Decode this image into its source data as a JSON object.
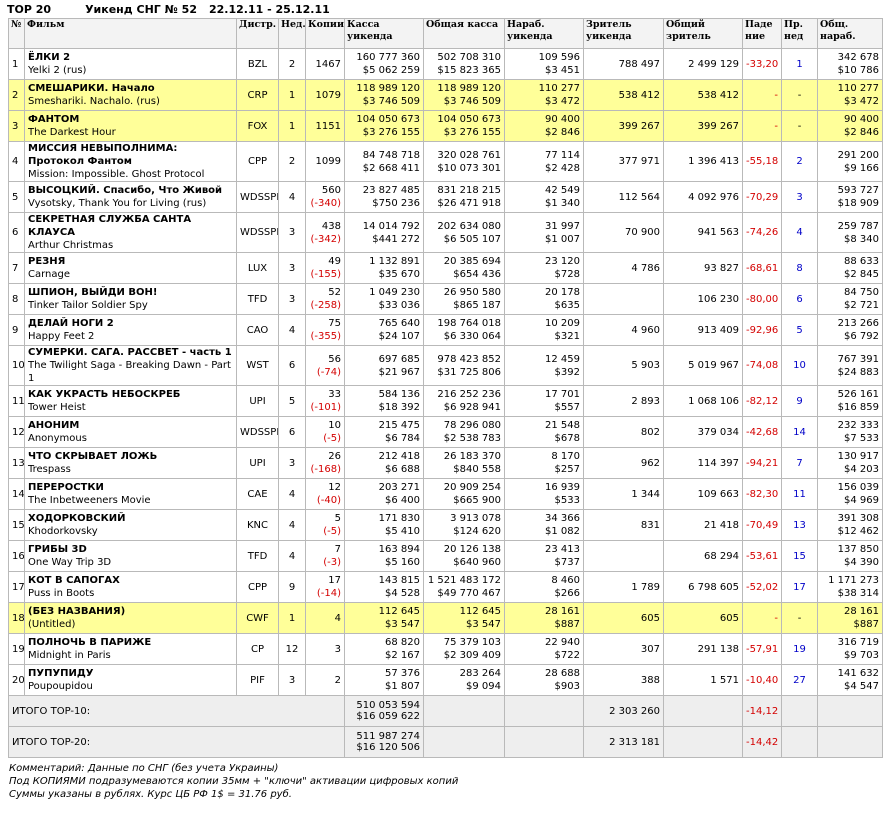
{
  "header": {
    "top": "TOP 20",
    "weekend": "Уикенд СНГ № 52",
    "dates": "22.12.11 - 25.12.11"
  },
  "columns": [
    "№",
    "Фильм",
    "Дистр.",
    "Нед.",
    "Копии",
    "Касса уикенда",
    "Общая касса",
    "Нараб. уикенда",
    "Зритель уикенда",
    "Общий зритель",
    "Паде ние",
    "Пр. нед",
    "Общ. нараб."
  ],
  "rows": [
    {
      "n": "1",
      "ru": "ЁЛКИ 2",
      "en": "Yelki 2 (rus)",
      "dist": "BZL",
      "week": "2",
      "copies": "1467",
      "copies_d": "",
      "box1": "160 777 360",
      "box2": "$5 062 259",
      "tot1": "502 708 310",
      "tot2": "$15 823 365",
      "avg1": "109 596",
      "avg2": "$3 451",
      "adm": "788 497",
      "tadm": "2 499 129",
      "drop": "-33,20",
      "prev": "1",
      "cavg1": "342 678",
      "cavg2": "$10 786",
      "hl": false
    },
    {
      "n": "2",
      "ru": "СМЕШАРИКИ. Начало",
      "en": "Smeshariki. Nachalo. (rus)",
      "dist": "CRP",
      "week": "1",
      "copies": "1079",
      "copies_d": "",
      "box1": "118 989 120",
      "box2": "$3 746 509",
      "tot1": "118 989 120",
      "tot2": "$3 746 509",
      "avg1": "110 277",
      "avg2": "$3 472",
      "adm": "538 412",
      "tadm": "538 412",
      "drop": "-",
      "prev": "-",
      "cavg1": "110 277",
      "cavg2": "$3 472",
      "hl": true
    },
    {
      "n": "3",
      "ru": "ФАНТОМ",
      "en": "The Darkest Hour",
      "dist": "FOX",
      "week": "1",
      "copies": "1151",
      "copies_d": "",
      "box1": "104 050 673",
      "box2": "$3 276 155",
      "tot1": "104 050 673",
      "tot2": "$3 276 155",
      "avg1": "90 400",
      "avg2": "$2 846",
      "adm": "399 267",
      "tadm": "399 267",
      "drop": "-",
      "prev": "-",
      "cavg1": "90 400",
      "cavg2": "$2 846",
      "hl": true
    },
    {
      "n": "4",
      "ru": "МИССИЯ НЕВЫПОЛНИМА: Протокол Фантом",
      "en": "Mission: Impossible. Ghost Protocol",
      "dist": "CPP",
      "week": "2",
      "copies": "1099",
      "copies_d": "",
      "box1": "84 748 718",
      "box2": "$2 668 411",
      "tot1": "320 028 761",
      "tot2": "$10 073 301",
      "avg1": "77 114",
      "avg2": "$2 428",
      "adm": "377 971",
      "tadm": "1 396 413",
      "drop": "-55,18",
      "prev": "2",
      "cavg1": "291 200",
      "cavg2": "$9 166",
      "hl": false
    },
    {
      "n": "5",
      "ru": "ВЫСОЦКИЙ. Спасибо, Что Живой",
      "en": "Vysotsky, Thank You for Living (rus)",
      "dist": "WDSSPR",
      "week": "4",
      "copies": "560",
      "copies_d": "(-340)",
      "box1": "23 827 485",
      "box2": "$750 236",
      "tot1": "831 218 215",
      "tot2": "$26 471 918",
      "avg1": "42 549",
      "avg2": "$1 340",
      "adm": "112 564",
      "tadm": "4 092 976",
      "drop": "-70,29",
      "prev": "3",
      "cavg1": "593 727",
      "cavg2": "$18 909",
      "hl": false
    },
    {
      "n": "6",
      "ru": "СЕКРЕТНАЯ СЛУЖБА САНТА КЛАУСА",
      "en": "Arthur Christmas",
      "dist": "WDSSPR",
      "week": "3",
      "copies": "438",
      "copies_d": "(-342)",
      "box1": "14 014 792",
      "box2": "$441 272",
      "tot1": "202 634 080",
      "tot2": "$6 505 107",
      "avg1": "31 997",
      "avg2": "$1 007",
      "adm": "70 900",
      "tadm": "941 563",
      "drop": "-74,26",
      "prev": "4",
      "cavg1": "259 787",
      "cavg2": "$8 340",
      "hl": false
    },
    {
      "n": "7",
      "ru": "РЕЗНЯ",
      "en": "Carnage",
      "dist": "LUX",
      "week": "3",
      "copies": "49",
      "copies_d": "(-155)",
      "box1": "1 132 891",
      "box2": "$35 670",
      "tot1": "20 385 694",
      "tot2": "$654 436",
      "avg1": "23 120",
      "avg2": "$728",
      "adm": "4 786",
      "tadm": "93 827",
      "drop": "-68,61",
      "prev": "8",
      "cavg1": "88 633",
      "cavg2": "$2 845",
      "hl": false
    },
    {
      "n": "8",
      "ru": "ШПИОН, ВЫЙДИ ВОН!",
      "en": "Tinker Tailor Soldier Spy",
      "dist": "TFD",
      "week": "3",
      "copies": "52",
      "copies_d": "(-258)",
      "box1": "1 049 230",
      "box2": "$33 036",
      "tot1": "26 950 580",
      "tot2": "$865 187",
      "avg1": "20 178",
      "avg2": "$635",
      "adm": "",
      "tadm": "106 230",
      "drop": "-80,00",
      "prev": "6",
      "cavg1": "84 750",
      "cavg2": "$2 721",
      "hl": false
    },
    {
      "n": "9",
      "ru": "ДЕЛАЙ НОГИ 2",
      "en": "Happy Feet 2",
      "dist": "CAO",
      "week": "4",
      "copies": "75",
      "copies_d": "(-355)",
      "box1": "765 640",
      "box2": "$24 107",
      "tot1": "198 764 018",
      "tot2": "$6 330 064",
      "avg1": "10 209",
      "avg2": "$321",
      "adm": "4 960",
      "tadm": "913 409",
      "drop": "-92,96",
      "prev": "5",
      "cavg1": "213 266",
      "cavg2": "$6 792",
      "hl": false
    },
    {
      "n": "10",
      "ru": "СУМЕРКИ. САГА. РАССВЕТ - часть 1",
      "en": "The Twilight Saga - Breaking Dawn - Part 1",
      "dist": "WST",
      "week": "6",
      "copies": "56",
      "copies_d": "(-74)",
      "box1": "697 685",
      "box2": "$21 967",
      "tot1": "978 423 852",
      "tot2": "$31 725 806",
      "avg1": "12 459",
      "avg2": "$392",
      "adm": "5 903",
      "tadm": "5 019 967",
      "drop": "-74,08",
      "prev": "10",
      "cavg1": "767 391",
      "cavg2": "$24 883",
      "hl": false
    },
    {
      "n": "11",
      "ru": "КАК УКРАСТЬ НЕБОСКРЕБ",
      "en": "Tower Heist",
      "dist": "UPI",
      "week": "5",
      "copies": "33",
      "copies_d": "(-101)",
      "box1": "584 136",
      "box2": "$18 392",
      "tot1": "216 252 236",
      "tot2": "$6 928 941",
      "avg1": "17 701",
      "avg2": "$557",
      "adm": "2 893",
      "tadm": "1 068 106",
      "drop": "-82,12",
      "prev": "9",
      "cavg1": "526 161",
      "cavg2": "$16 859",
      "hl": false
    },
    {
      "n": "12",
      "ru": "АНОНИМ",
      "en": "Anonymous",
      "dist": "WDSSPR",
      "week": "6",
      "copies": "10",
      "copies_d": "(-5)",
      "box1": "215 475",
      "box2": "$6 784",
      "tot1": "78 296 080",
      "tot2": "$2 538 783",
      "avg1": "21 548",
      "avg2": "$678",
      "adm": "802",
      "tadm": "379 034",
      "drop": "-42,68",
      "prev": "14",
      "cavg1": "232 333",
      "cavg2": "$7 533",
      "hl": false
    },
    {
      "n": "13",
      "ru": "ЧТО СКРЫВАЕТ ЛОЖЬ",
      "en": "Trespass",
      "dist": "UPI",
      "week": "3",
      "copies": "26",
      "copies_d": "(-168)",
      "box1": "212 418",
      "box2": "$6 688",
      "tot1": "26 183 370",
      "tot2": "$840 558",
      "avg1": "8 170",
      "avg2": "$257",
      "adm": "962",
      "tadm": "114 397",
      "drop": "-94,21",
      "prev": "7",
      "cavg1": "130 917",
      "cavg2": "$4 203",
      "hl": false
    },
    {
      "n": "14",
      "ru": "ПЕРЕРОСТКИ",
      "en": "The Inbetweeners Movie",
      "dist": "CAE",
      "week": "4",
      "copies": "12",
      "copies_d": "(-40)",
      "box1": "203 271",
      "box2": "$6 400",
      "tot1": "20 909 254",
      "tot2": "$665 900",
      "avg1": "16 939",
      "avg2": "$533",
      "adm": "1 344",
      "tadm": "109 663",
      "drop": "-82,30",
      "prev": "11",
      "cavg1": "156 039",
      "cavg2": "$4 969",
      "hl": false
    },
    {
      "n": "15",
      "ru": "ХОДОРКОВСКИЙ",
      "en": "Khodorkovsky",
      "dist": "KNC",
      "week": "4",
      "copies": "5",
      "copies_d": "(-5)",
      "box1": "171 830",
      "box2": "$5 410",
      "tot1": "3 913 078",
      "tot2": "$124 620",
      "avg1": "34 366",
      "avg2": "$1 082",
      "adm": "831",
      "tadm": "21 418",
      "drop": "-70,49",
      "prev": "13",
      "cavg1": "391 308",
      "cavg2": "$12 462",
      "hl": false
    },
    {
      "n": "16",
      "ru": "ГРИБЫ 3D",
      "en": "One Way Trip 3D",
      "dist": "TFD",
      "week": "4",
      "copies": "7",
      "copies_d": "(-3)",
      "box1": "163 894",
      "box2": "$5 160",
      "tot1": "20 126 138",
      "tot2": "$640 960",
      "avg1": "23 413",
      "avg2": "$737",
      "adm": "",
      "tadm": "68 294",
      "drop": "-53,61",
      "prev": "15",
      "cavg1": "137 850",
      "cavg2": "$4 390",
      "hl": false
    },
    {
      "n": "17",
      "ru": "КОТ В САПОГАХ",
      "en": "Puss in Boots",
      "dist": "CPP",
      "week": "9",
      "copies": "17",
      "copies_d": "(-14)",
      "box1": "143 815",
      "box2": "$4 528",
      "tot1": "1 521 483 172",
      "tot2": "$49 770 467",
      "avg1": "8 460",
      "avg2": "$266",
      "adm": "1 789",
      "tadm": "6 798 605",
      "drop": "-52,02",
      "prev": "17",
      "cavg1": "1 171 273",
      "cavg2": "$38 314",
      "hl": false
    },
    {
      "n": "18",
      "ru": "(БЕЗ НАЗВАНИЯ)",
      "en": "(Untitled)",
      "dist": "CWF",
      "week": "1",
      "copies": "4",
      "copies_d": "",
      "box1": "112 645",
      "box2": "$3 547",
      "tot1": "112 645",
      "tot2": "$3 547",
      "avg1": "28 161",
      "avg2": "$887",
      "adm": "605",
      "tadm": "605",
      "drop": "-",
      "prev": "-",
      "cavg1": "28 161",
      "cavg2": "$887",
      "hl": true
    },
    {
      "n": "19",
      "ru": "ПОЛНОЧЬ В ПАРИЖЕ",
      "en": "Midnight in Paris",
      "dist": "CP",
      "week": "12",
      "copies": "3",
      "copies_d": "",
      "box1": "68 820",
      "box2": "$2 167",
      "tot1": "75 379 103",
      "tot2": "$2 309 409",
      "avg1": "22 940",
      "avg2": "$722",
      "adm": "307",
      "tadm": "291 138",
      "drop": "-57,91",
      "prev": "19",
      "cavg1": "316 719",
      "cavg2": "$9 703",
      "hl": false
    },
    {
      "n": "20",
      "ru": "ПУПУПИДУ",
      "en": "Poupoupidou",
      "dist": "PIF",
      "week": "3",
      "copies": "2",
      "copies_d": "",
      "box1": "57 376",
      "box2": "$1 807",
      "tot1": "283 264",
      "tot2": "$9 094",
      "avg1": "28 688",
      "avg2": "$903",
      "adm": "388",
      "tadm": "1 571",
      "drop": "-10,40",
      "prev": "27",
      "cavg1": "141 632",
      "cavg2": "$4 547",
      "hl": false
    }
  ],
  "totals": [
    {
      "label": "ИТОГО TOP-10:",
      "box1": "510 053 594",
      "box2": "$16 059 622",
      "adm": "2 303 260",
      "drop": "-14,12"
    },
    {
      "label": "ИТОГО TOP-20:",
      "box1": "511 987 274",
      "box2": "$16 120 506",
      "adm": "2 313 181",
      "drop": "-14,42"
    }
  ],
  "notes": [
    "Комментарий: Данные по СНГ (без учета Украины)",
    "Под КОПИЯМИ подразумеваются копии 35мм + \"ключи\" активации цифровых копий",
    "Суммы указаны в рублях. Курс ЦБ РФ 1$ = 31.76 руб."
  ],
  "colors": {
    "highlight": "#ffff99",
    "negative": "#d40000",
    "prev_week": "#0000c8"
  }
}
